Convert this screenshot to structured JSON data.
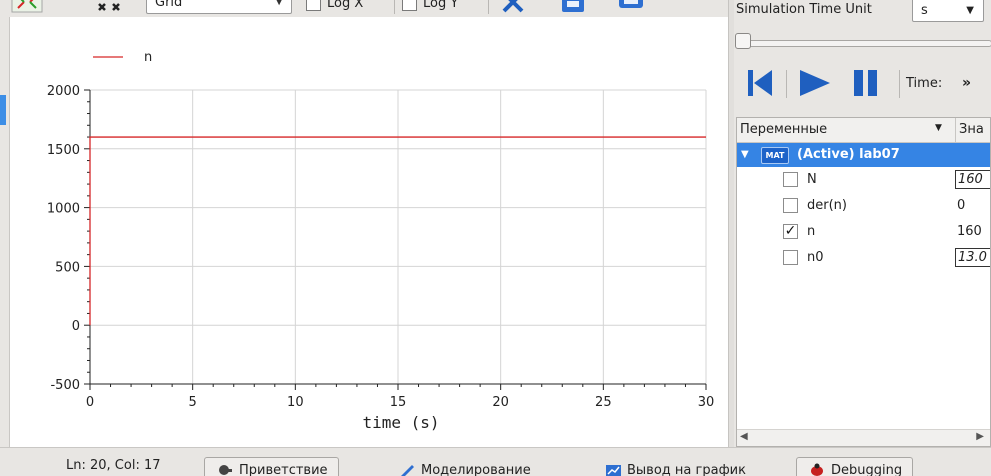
{
  "toolbar": {
    "grid_select": "Grid",
    "log_x_label": "Log X",
    "log_y_label": "Log Y"
  },
  "right_panel": {
    "sim_time_unit_label": "Simulation Time Unit",
    "sim_time_unit_value": "s",
    "time_label": "Time:",
    "more_glyph": "»",
    "variables_header": "Переменные",
    "values_header": "Зна",
    "model_label": "(Active) lab07",
    "model_icon_text": "MAT",
    "variables": [
      {
        "name": "N",
        "value": "160",
        "checked": false,
        "editable": true
      },
      {
        "name": "der(n)",
        "value": "0",
        "checked": false,
        "editable": false
      },
      {
        "name": "n",
        "value": "160",
        "checked": true,
        "editable": false
      },
      {
        "name": "n0",
        "value": "13.0",
        "checked": false,
        "editable": true
      }
    ]
  },
  "statusbar": {
    "cursor_position": "Ln: 20, Col: 17",
    "tabs": [
      "Приветствие",
      "Моделирование",
      "Вывод на график",
      "Debugging"
    ]
  },
  "colors": {
    "series_line": "#d62728",
    "selection": "#3584e4",
    "grid": "#d4d4d4"
  },
  "chart_data": {
    "type": "line",
    "xlabel": "time (s)",
    "ylabel": "",
    "xlim": [
      0,
      30
    ],
    "ylim": [
      -500,
      2000
    ],
    "x_ticks": [
      0,
      5,
      10,
      15,
      20,
      25,
      30
    ],
    "y_ticks": [
      -500,
      0,
      500,
      1000,
      1500,
      2000
    ],
    "grid": true,
    "legend_position": "top-left",
    "series": [
      {
        "name": "n",
        "color": "#d62728",
        "x": [
          0,
          0,
          30
        ],
        "y": [
          0,
          1600,
          1600
        ]
      }
    ]
  }
}
